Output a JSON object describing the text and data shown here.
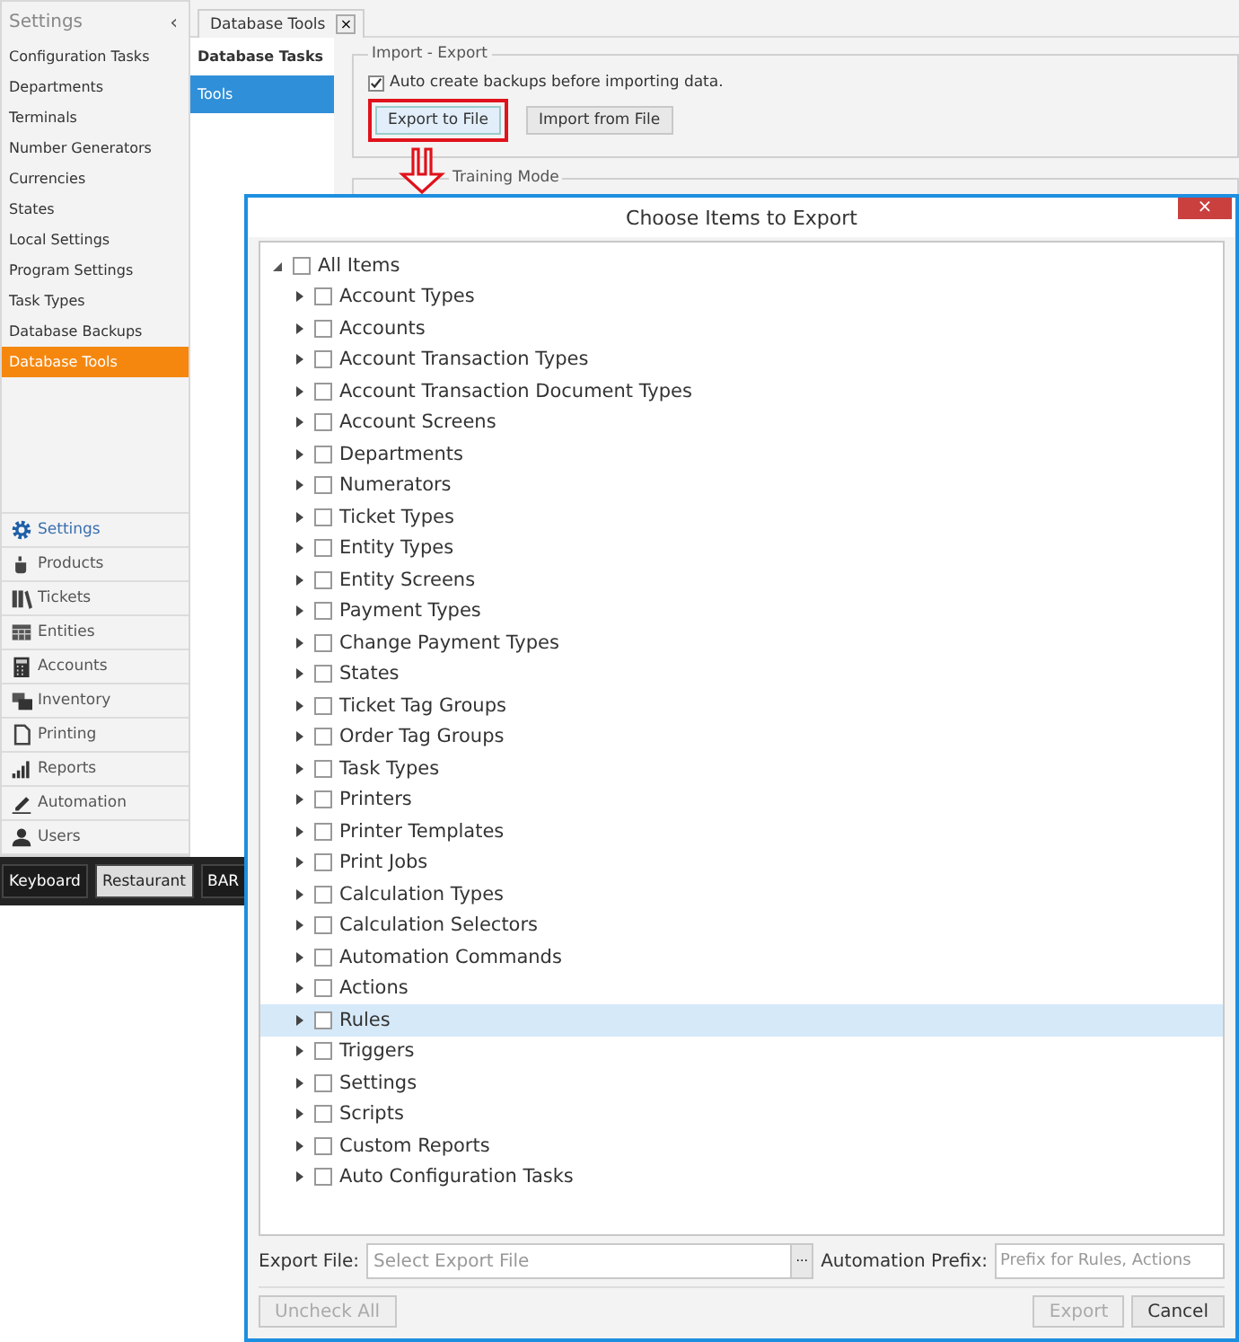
{
  "settings_panel": {
    "title": "Settings",
    "collapse_glyph": "‹",
    "items": [
      {
        "label": "Configuration Tasks",
        "selected": false
      },
      {
        "label": "Departments",
        "selected": false
      },
      {
        "label": "Terminals",
        "selected": false
      },
      {
        "label": "Number Generators",
        "selected": false
      },
      {
        "label": "Currencies",
        "selected": false
      },
      {
        "label": "States",
        "selected": false
      },
      {
        "label": "Local Settings",
        "selected": false
      },
      {
        "label": "Program Settings",
        "selected": false
      },
      {
        "label": "Task Types",
        "selected": false
      },
      {
        "label": "Database Backups",
        "selected": false
      },
      {
        "label": "Database Tools",
        "selected": true
      }
    ]
  },
  "navigation": [
    {
      "label": "Settings",
      "selected": true
    },
    {
      "label": "Products",
      "selected": false
    },
    {
      "label": "Tickets",
      "selected": false
    },
    {
      "label": "Entities",
      "selected": false
    },
    {
      "label": "Accounts",
      "selected": false
    },
    {
      "label": "Inventory",
      "selected": false
    },
    {
      "label": "Printing",
      "selected": false
    },
    {
      "label": "Reports",
      "selected": false
    },
    {
      "label": "Automation",
      "selected": false
    },
    {
      "label": "Users",
      "selected": false
    }
  ],
  "bottom_bar": [
    {
      "label": "Keyboard",
      "selected": false
    },
    {
      "label": "Restaurant",
      "selected": true
    },
    {
      "label": "BAR",
      "selected": false
    }
  ],
  "document_tab": {
    "label": "Database Tools",
    "close_glyph": "×"
  },
  "tool_tabs": [
    {
      "label": "Database Tasks",
      "selected": false
    },
    {
      "label": "Tools",
      "selected": true
    }
  ],
  "import_export": {
    "title": "Import - Export",
    "auto_backup": {
      "label": "Auto create backups before importing data.",
      "checked": true
    },
    "buttons": [
      {
        "label": "Export to File",
        "highlighted": true
      },
      {
        "label": "Import from File",
        "highlighted": false
      }
    ]
  },
  "training_mode": {
    "title": "Training Mode"
  },
  "dialog": {
    "title": "Choose Items to Export",
    "close_glyph": "×",
    "tree": {
      "label": "All Items",
      "expanded": true,
      "checked": false,
      "selected": false,
      "children": [
        {
          "label": "Account Types",
          "expanded": false,
          "checked": false,
          "selected": false
        },
        {
          "label": "Accounts",
          "expanded": false,
          "checked": false,
          "selected": false
        },
        {
          "label": "Account Transaction Types",
          "expanded": false,
          "checked": false,
          "selected": false
        },
        {
          "label": "Account Transaction Document Types",
          "expanded": false,
          "checked": false,
          "selected": false
        },
        {
          "label": "Account Screens",
          "expanded": false,
          "checked": false,
          "selected": false
        },
        {
          "label": "Departments",
          "expanded": false,
          "checked": false,
          "selected": false
        },
        {
          "label": "Numerators",
          "expanded": false,
          "checked": false,
          "selected": false
        },
        {
          "label": "Ticket Types",
          "expanded": false,
          "checked": false,
          "selected": false
        },
        {
          "label": "Entity Types",
          "expanded": false,
          "checked": false,
          "selected": false
        },
        {
          "label": "Entity Screens",
          "expanded": false,
          "checked": false,
          "selected": false
        },
        {
          "label": "Payment Types",
          "expanded": false,
          "checked": false,
          "selected": false
        },
        {
          "label": "Change Payment Types",
          "expanded": false,
          "checked": false,
          "selected": false
        },
        {
          "label": "States",
          "expanded": false,
          "checked": false,
          "selected": false
        },
        {
          "label": "Ticket Tag Groups",
          "expanded": false,
          "checked": false,
          "selected": false
        },
        {
          "label": "Order Tag Groups",
          "expanded": false,
          "checked": false,
          "selected": false
        },
        {
          "label": "Task Types",
          "expanded": false,
          "checked": false,
          "selected": false
        },
        {
          "label": "Printers",
          "expanded": false,
          "checked": false,
          "selected": false
        },
        {
          "label": "Printer Templates",
          "expanded": false,
          "checked": false,
          "selected": false
        },
        {
          "label": "Print Jobs",
          "expanded": false,
          "checked": false,
          "selected": false
        },
        {
          "label": "Calculation Types",
          "expanded": false,
          "checked": false,
          "selected": false
        },
        {
          "label": "Calculation Selectors",
          "expanded": false,
          "checked": false,
          "selected": false
        },
        {
          "label": "Automation Commands",
          "expanded": false,
          "checked": false,
          "selected": false
        },
        {
          "label": "Actions",
          "expanded": false,
          "checked": false,
          "selected": false
        },
        {
          "label": "Rules",
          "expanded": false,
          "checked": false,
          "selected": true
        },
        {
          "label": "Triggers",
          "expanded": false,
          "checked": false,
          "selected": false
        },
        {
          "label": "Settings",
          "expanded": false,
          "checked": false,
          "selected": false
        },
        {
          "label": "Scripts",
          "expanded": false,
          "checked": false,
          "selected": false
        },
        {
          "label": "Custom Reports",
          "expanded": false,
          "checked": false,
          "selected": false
        },
        {
          "label": "Auto Configuration Tasks",
          "expanded": false,
          "checked": false,
          "selected": false
        }
      ]
    },
    "export_file": {
      "label": "Export File:",
      "placeholder": "Select Export File",
      "browse_glyph": "···"
    },
    "automation_prefix": {
      "label": "Automation Prefix:",
      "placeholder": "Prefix for Rules, Actions"
    },
    "left_buttons": [
      {
        "label": "Uncheck All",
        "disabled": true
      }
    ],
    "right_buttons": [
      {
        "label": "Export",
        "disabled": true
      },
      {
        "label": "Cancel",
        "disabled": false
      }
    ]
  }
}
